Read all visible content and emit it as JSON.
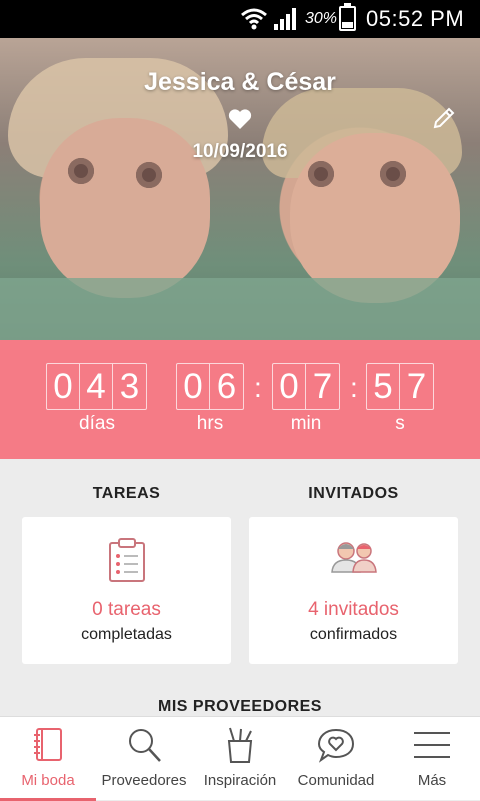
{
  "status_bar": {
    "battery": "30%",
    "time": "05:52 PM",
    "wifi_icon": "wifi-icon",
    "signal_icon": "signal-icon"
  },
  "hero": {
    "names": "Jessica & César",
    "date": "10/09/2016",
    "edit_icon": "pencil-icon",
    "heart_icon": "heart-icon"
  },
  "countdown": {
    "days": [
      "0",
      "4",
      "3"
    ],
    "hours": [
      "0",
      "6"
    ],
    "minutes": [
      "0",
      "7"
    ],
    "seconds": [
      "5",
      "7"
    ],
    "labels": {
      "days": "días",
      "hours": "hrs",
      "minutes": "min",
      "seconds": "s"
    },
    "color": "#f57b86"
  },
  "tasks": {
    "title": "TAREAS",
    "count": "0 tareas",
    "subtitle": "completadas",
    "icon": "clipboard-icon"
  },
  "guests": {
    "title": "INVITADOS",
    "count": "4 invitados",
    "subtitle": "confirmados",
    "icon": "guests-icon"
  },
  "providers_title": "MIS PROVEEDORES",
  "nav": {
    "items": [
      {
        "label": "Mi boda",
        "icon": "notebook-icon"
      },
      {
        "label": "Proveedores",
        "icon": "search-icon"
      },
      {
        "label": "Inspiración",
        "icon": "pencil-cup-icon"
      },
      {
        "label": "Comunidad",
        "icon": "chat-heart-icon"
      },
      {
        "label": "Más",
        "icon": "menu-icon"
      }
    ],
    "active_color": "#e8636e"
  }
}
